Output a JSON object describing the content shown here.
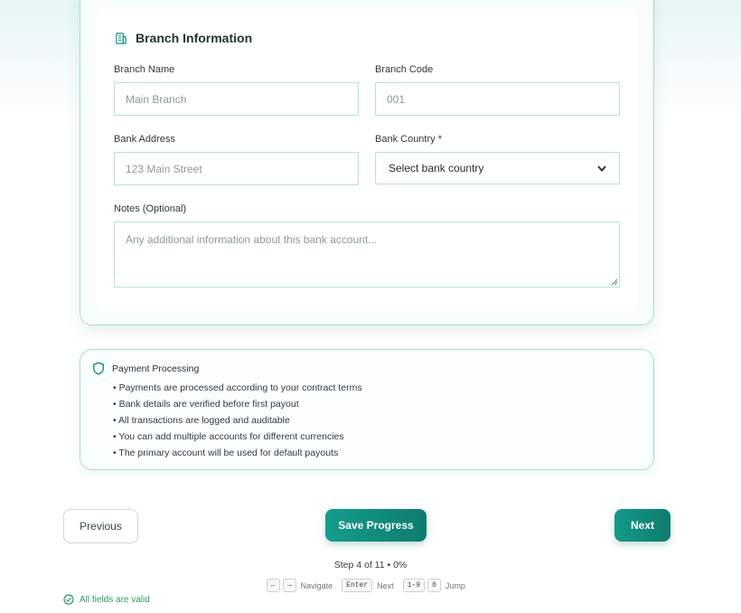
{
  "branch_section": {
    "title": "Branch Information",
    "icon": "building-icon",
    "branch_name": {
      "label": "Branch Name",
      "placeholder": "Main Branch",
      "value": ""
    },
    "branch_code": {
      "label": "Branch Code",
      "placeholder": "001",
      "value": ""
    },
    "bank_address": {
      "label": "Bank Address",
      "placeholder": "123 Main Street",
      "value": ""
    },
    "bank_country": {
      "label": "Bank Country *",
      "selected": "Select bank country"
    },
    "notes": {
      "label": "Notes (Optional)",
      "placeholder": "Any additional information about this bank account..."
    }
  },
  "info_box": {
    "title": "Payment Processing",
    "icon": "shield-icon",
    "items": [
      "Payments are processed according to your contract terms",
      "Bank details are verified before first payout",
      "All transactions are logged and auditable",
      "You can add multiple accounts for different currencies",
      "The primary account will be used for default payouts"
    ]
  },
  "navigation": {
    "previous_label": "Previous",
    "save_label": "Save Progress",
    "next_label": "Next",
    "progress_text": "Step 4 of 11 • 0%"
  },
  "shortcuts": {
    "prev_key": "←",
    "next_key": "→",
    "navigate_label": "Navigate",
    "enter_key": "Enter",
    "enter_label": "Next",
    "digits_key": "1-9",
    "zero_key": "0",
    "jump_label": "Jump"
  },
  "validation": {
    "text": "All fields are valid",
    "icon": "check-circle-icon"
  },
  "colors": {
    "accent": "#0e8f7f",
    "border": "#b3e5dc",
    "valid": "#2e9a5e"
  }
}
